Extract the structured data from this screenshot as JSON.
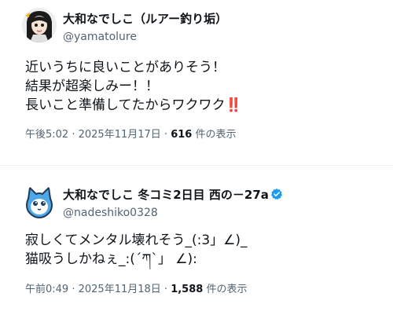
{
  "tweets": [
    {
      "author": {
        "display_name": "大和なでしこ（ルアー釣り垢）",
        "handle": "@yamatolure",
        "avatar_icon": "anime-girl-avatar-icon"
      },
      "body_lines": [
        "近いうちに良いことがありそう！",
        "結果が超楽しみー！！",
        "長いこと準備してたからワクワク"
      ],
      "body_emoji": "‼️",
      "time": "午後5:02",
      "date": "2025年11月17日",
      "separator": " · ",
      "views_count": "616",
      "views_label": "件の表示"
    },
    {
      "author": {
        "display_name": "大和なでしこ 冬コミ2日目 西の－27a",
        "handle": "@nadeshiko0328",
        "avatar_icon": "blue-cat-avatar-icon",
        "verified": true
      },
      "body_lines": [
        "寂しくてメンタル壊れそう_(:3」∠)_",
        "猫吸うしかねぇ_:(´ཀ`」 ∠):"
      ],
      "time": "午前0:49",
      "date": "2025年11月18日",
      "separator": " · ",
      "views_count": "1,588",
      "views_label": "件の表示"
    }
  ],
  "colors": {
    "text_primary": "#0f1419",
    "text_secondary": "#536471",
    "verified_blue": "#1d9bf0",
    "divider": "#eff3f4",
    "emoji_red": "#d0021b"
  }
}
